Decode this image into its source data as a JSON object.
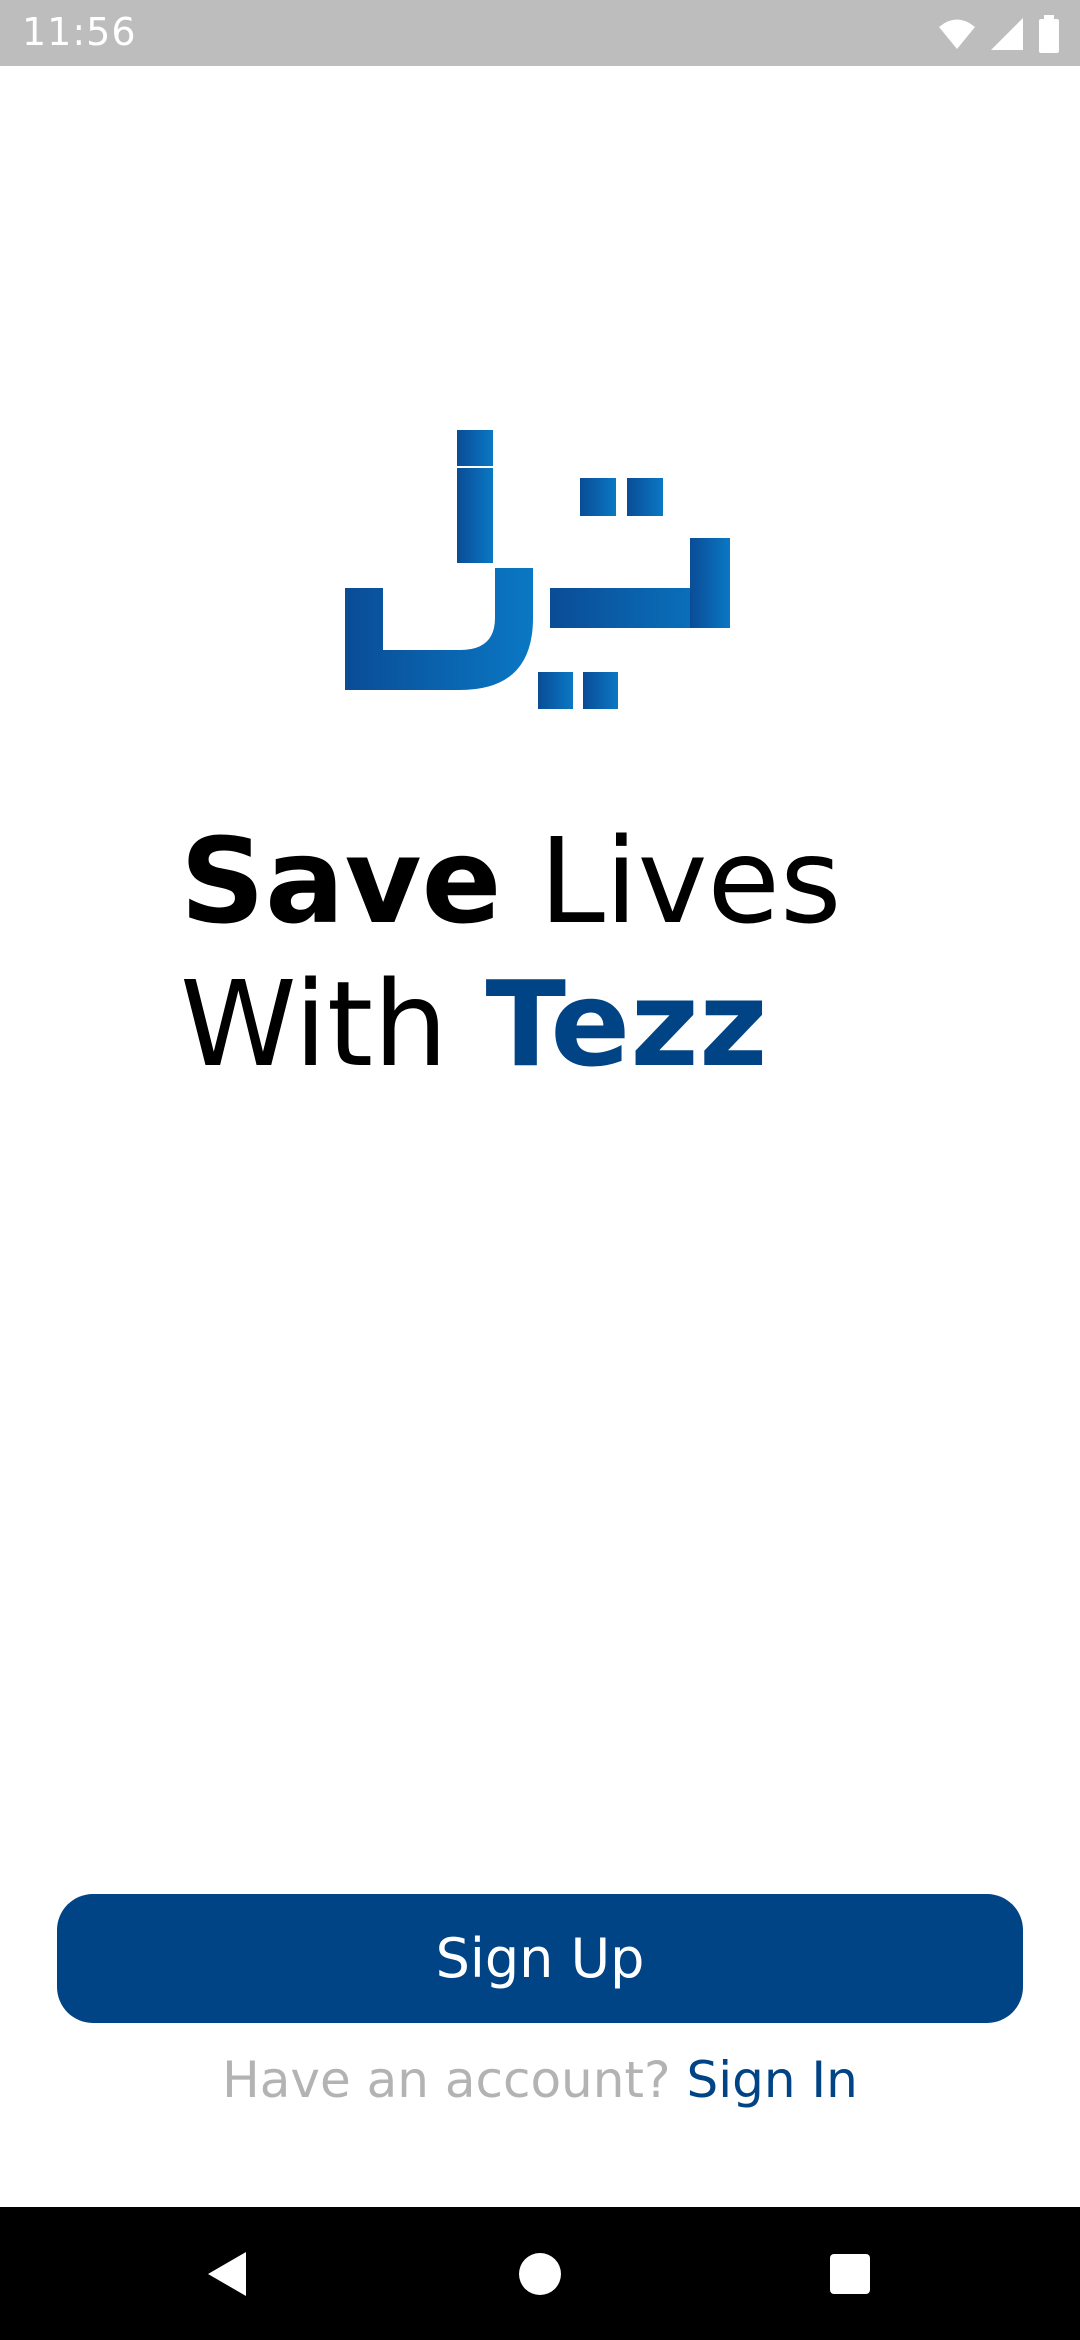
{
  "status_bar": {
    "time": "11:56",
    "icons": [
      "wifi-icon",
      "cell-signal-icon",
      "battery-icon"
    ]
  },
  "logo": {
    "icon": "tezz-logo-icon",
    "colors": [
      "#0a4c96",
      "#0a78c4"
    ]
  },
  "headline": {
    "line1_bold": "Save",
    "line1_light": "Lives",
    "line2_light": "With",
    "line2_brand": "Tezz"
  },
  "actions": {
    "signup_label": "Sign Up",
    "signin_prompt": "Have an account?",
    "signin_link": "Sign In"
  },
  "nav_bar": {
    "icons": [
      "back-icon",
      "home-icon",
      "recents-icon"
    ]
  },
  "colors": {
    "brand": "#004485",
    "status_bar": "#bdbdbd",
    "muted_text": "#b3b3b3"
  }
}
